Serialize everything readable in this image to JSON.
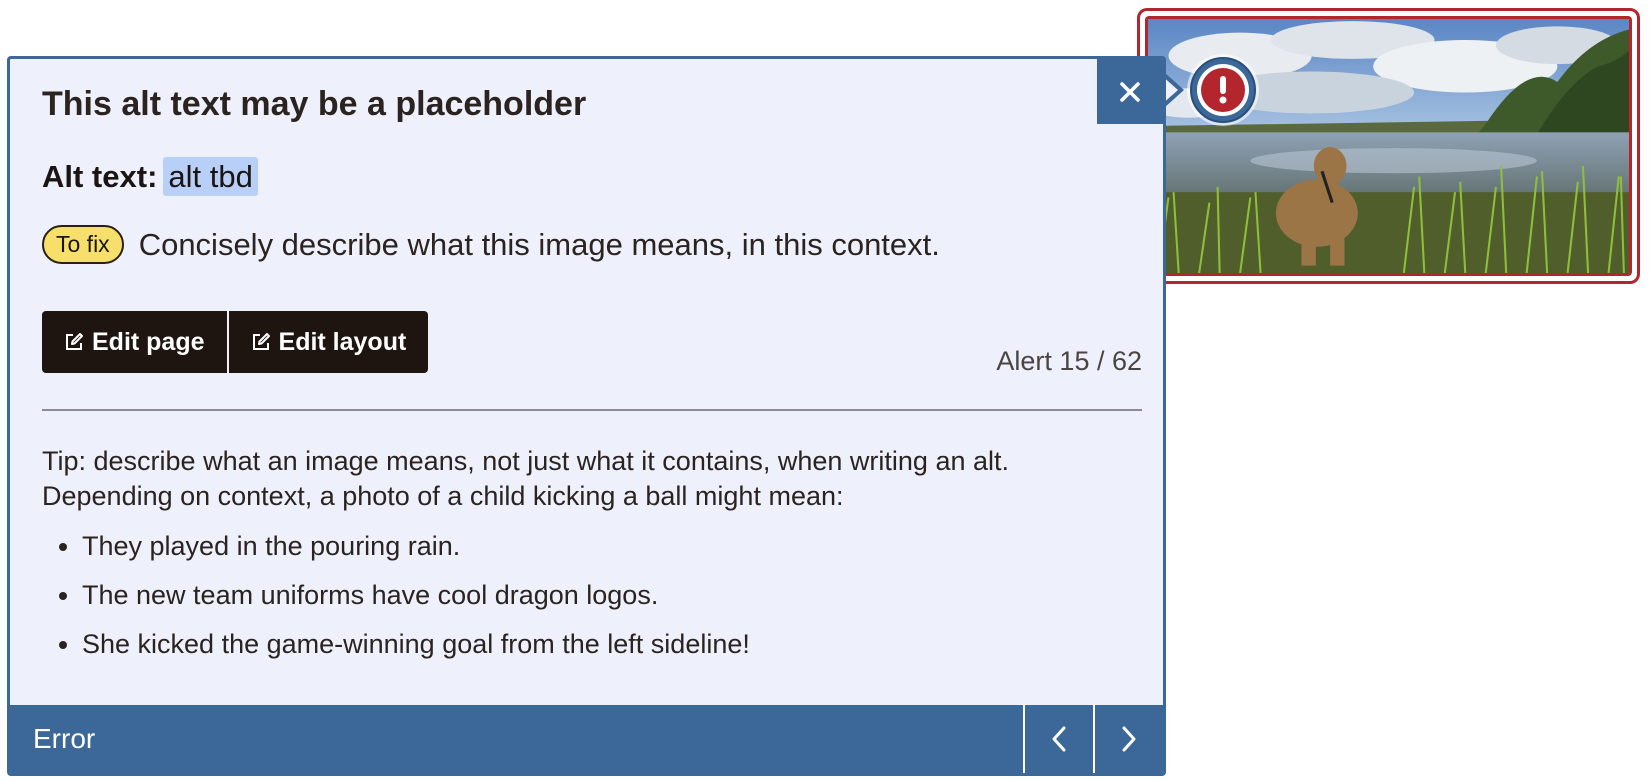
{
  "image": {
    "description_icon": "landscape-photo-dog-at-lake"
  },
  "dialog": {
    "heading": "This alt text may be a placeholder",
    "alt_label": "Alt text:",
    "alt_value": "alt tbd",
    "fix_badge": "To fix",
    "fix_text": "Concisely describe what this image means, in this context.",
    "buttons": {
      "edit_page": "Edit page",
      "edit_layout": "Edit layout"
    },
    "alert_count": "Alert 15 / 62",
    "tip": "Tip: describe what an image means, not just what it contains, when writing an alt. Depending on context, a photo of a child kicking a ball might mean:",
    "tip_items": [
      "They played in the pouring rain.",
      "The new team uniforms have cool dragon logos.",
      "She kicked the game-winning goal from the left sideline!"
    ],
    "footer_label": "Error"
  },
  "colors": {
    "accent": "#3b6899",
    "error": "#b3262e",
    "dialog_bg": "#eef0fb",
    "badge": "#f7df6b",
    "button_bg": "#1e1410"
  }
}
